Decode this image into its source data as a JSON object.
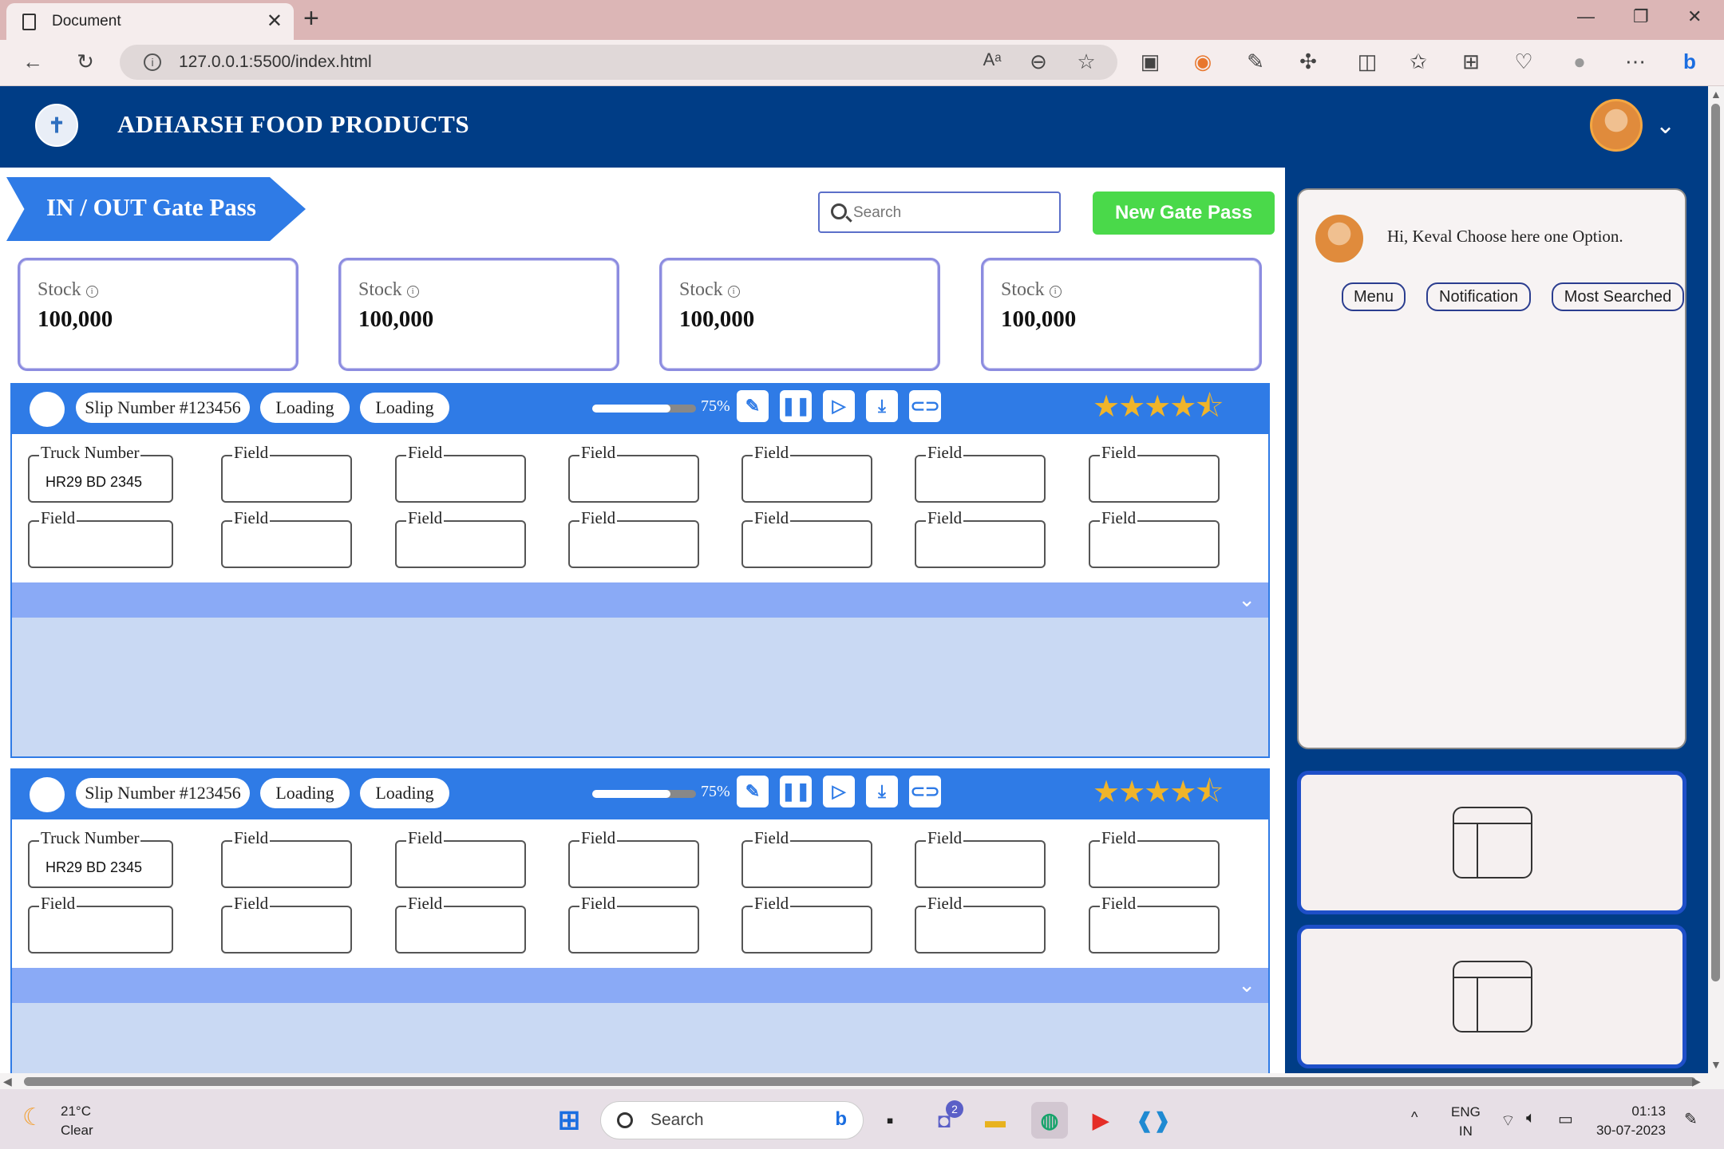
{
  "browser": {
    "tab_title": "Document",
    "url": "127.0.0.1:5500/index.html",
    "window_controls": [
      "minimize-icon",
      "restore-icon",
      "close-icon"
    ]
  },
  "app": {
    "company": "ADHARSH FOOD PRODUCTS",
    "page_title": "IN / OUT Gate Pass",
    "search_placeholder": "Search",
    "new_button": "New Gate Pass",
    "brand_color": "#003d86",
    "accent_color": "#2f7be6",
    "button_color": "#4ad94a"
  },
  "stocks": [
    {
      "label": "Stock",
      "value": "100,000"
    },
    {
      "label": "Stock",
      "value": "100,000"
    },
    {
      "label": "Stock",
      "value": "100,000"
    },
    {
      "label": "Stock",
      "value": "100,000"
    }
  ],
  "slips": [
    {
      "slip_number": "Slip Number #123456",
      "status1": "Loading",
      "status2": "Loading",
      "progress": 75,
      "progress_label": "75%",
      "rating": 4.5,
      "rating_max": 5,
      "fields_row1": [
        {
          "label": "Truck Number",
          "value": "HR29 BD 2345"
        },
        {
          "label": "Field",
          "value": ""
        },
        {
          "label": "Field",
          "value": ""
        },
        {
          "label": "Field",
          "value": ""
        },
        {
          "label": "Field",
          "value": ""
        },
        {
          "label": "Field",
          "value": ""
        },
        {
          "label": "Field",
          "value": ""
        }
      ],
      "fields_row2": [
        {
          "label": "Field",
          "value": ""
        },
        {
          "label": "Field",
          "value": ""
        },
        {
          "label": "Field",
          "value": ""
        },
        {
          "label": "Field",
          "value": ""
        },
        {
          "label": "Field",
          "value": ""
        },
        {
          "label": "Field",
          "value": ""
        },
        {
          "label": "Field",
          "value": ""
        }
      ]
    },
    {
      "slip_number": "Slip Number #123456",
      "status1": "Loading",
      "status2": "Loading",
      "progress": 75,
      "progress_label": "75%",
      "rating": 4.5,
      "rating_max": 5,
      "fields_row1": [
        {
          "label": "Truck Number",
          "value": "HR29 BD 2345"
        },
        {
          "label": "Field",
          "value": ""
        },
        {
          "label": "Field",
          "value": ""
        },
        {
          "label": "Field",
          "value": ""
        },
        {
          "label": "Field",
          "value": ""
        },
        {
          "label": "Field",
          "value": ""
        },
        {
          "label": "Field",
          "value": ""
        }
      ],
      "fields_row2": [
        {
          "label": "Field",
          "value": ""
        },
        {
          "label": "Field",
          "value": ""
        },
        {
          "label": "Field",
          "value": ""
        },
        {
          "label": "Field",
          "value": ""
        },
        {
          "label": "Field",
          "value": ""
        },
        {
          "label": "Field",
          "value": ""
        },
        {
          "label": "Field",
          "value": ""
        }
      ]
    }
  ],
  "slip_actions": [
    "edit-icon",
    "pause-icon",
    "play-icon",
    "download-icon",
    "link-icon"
  ],
  "chat": {
    "greeting": "Hi, Keval Choose here one Option.",
    "options": [
      "Menu",
      "Notification",
      "Most Searched"
    ]
  },
  "taskbar": {
    "temperature": "21°C",
    "weather": "Clear",
    "search": "Search",
    "chat_badge": "2",
    "lang1": "ENG",
    "lang2": "IN",
    "time": "01:13",
    "date": "30-07-2023"
  }
}
